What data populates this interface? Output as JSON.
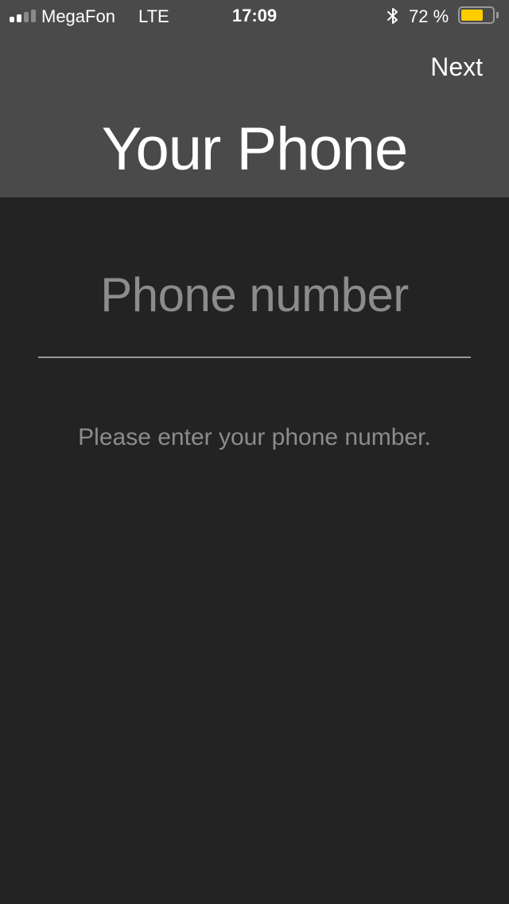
{
  "status_bar": {
    "carrier": "MegaFon",
    "network": "LTE",
    "time": "17:09",
    "battery_percent_label": "72 %",
    "battery_level": 0.72,
    "signal_bars_active": 2,
    "signal_bars_total": 4,
    "icons": [
      "signal-icon",
      "bluetooth-icon",
      "battery-icon"
    ],
    "colors": {
      "battery_fill": "#ffcc00",
      "signal_active": "#ffffff",
      "signal_inactive": "#8a8a8a"
    }
  },
  "nav": {
    "next_label": "Next"
  },
  "header": {
    "title": "Your Phone"
  },
  "form": {
    "phone_placeholder": "Phone number",
    "phone_value": "",
    "hint": "Please enter your phone number."
  },
  "colors": {
    "header_bg": "#4a4a4a",
    "body_bg": "#232323",
    "muted_text": "#8c8c8c"
  }
}
